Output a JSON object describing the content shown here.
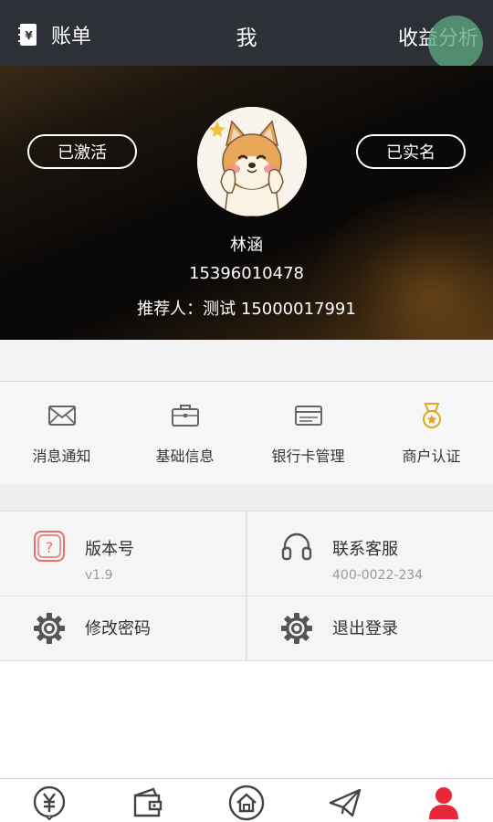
{
  "header": {
    "bill_label": "账单",
    "title": "我",
    "analysis_label": "收益分析"
  },
  "profile": {
    "activated_label": "已激活",
    "verified_label": "已实名",
    "name": "林涵",
    "phone": "15396010478",
    "referrer": "推荐人：测试 15000017991"
  },
  "quick_menu": [
    {
      "label": "消息通知",
      "icon": "envelope-icon"
    },
    {
      "label": "基础信息",
      "icon": "briefcase-icon"
    },
    {
      "label": "银行卡管理",
      "icon": "bank-card-icon"
    },
    {
      "label": "商户认证",
      "icon": "medal-icon"
    }
  ],
  "settings": {
    "version": {
      "label": "版本号",
      "value": "v1.9",
      "icon": "question-icon"
    },
    "support": {
      "label": "联系客服",
      "value": "400-0022-234",
      "icon": "headset-icon"
    },
    "password": {
      "label": "修改密码",
      "icon": "gear-icon"
    },
    "logout": {
      "label": "退出登录",
      "icon": "gear-icon"
    }
  },
  "tabbar": [
    {
      "icon": "yuan-coin-icon",
      "active": false
    },
    {
      "icon": "wallet-icon",
      "active": false
    },
    {
      "icon": "home-icon",
      "active": false
    },
    {
      "icon": "send-icon",
      "active": false
    },
    {
      "icon": "user-icon",
      "active": true
    }
  ],
  "colors": {
    "topbar": "#2d3036",
    "accent": "#e8283a",
    "medal": "#e0a81f",
    "question_icon": "#ec6b6b"
  }
}
